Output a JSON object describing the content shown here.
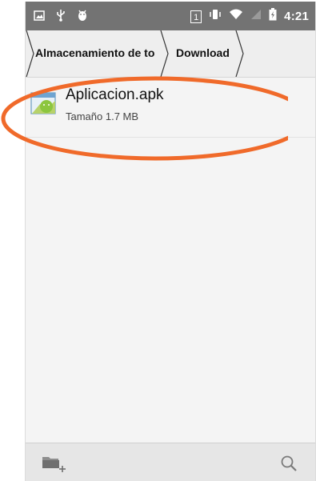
{
  "status_bar": {
    "time": "4:21",
    "sim_slot": "1",
    "icons": [
      "image-icon",
      "usb-icon",
      "android-debug-icon",
      "sim-slot-icon",
      "vibrate-icon",
      "wifi-icon",
      "no-signal-icon",
      "battery-charging-icon"
    ]
  },
  "breadcrumb": {
    "items": [
      {
        "label": "Almacenamiento de to"
      },
      {
        "label": "Download"
      }
    ]
  },
  "file_list": [
    {
      "name": "Aplicacion.apk",
      "size_text": "Tamaño 1.7 MB",
      "icon": "apk-file-icon"
    }
  ],
  "bottom_bar": {
    "actions": [
      "new-folder-icon",
      "search-icon"
    ]
  },
  "colors": {
    "status_bar": "#737373",
    "highlight_ellipse": "#f06a2a",
    "background": "#f4f4f4"
  }
}
